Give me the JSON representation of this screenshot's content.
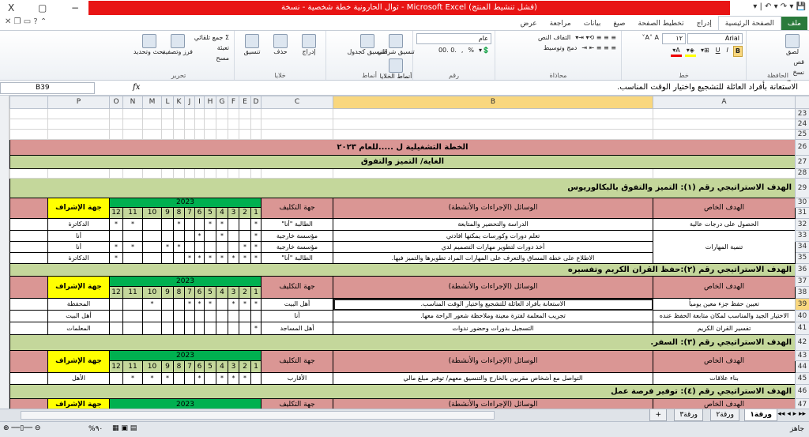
{
  "window": {
    "title": "ثوال الحارونية خطة شخصية - نسخة - Microsoft Excel (فشل تنشيط المنتج)",
    "close": "X",
    "restore": "▢",
    "minimize": "−"
  },
  "qat": "▾ | ↶ ▾ ↷ ▾ 💾",
  "ribbon_tabs": [
    "ملف",
    "الصفحة الرئيسية",
    "إدراج",
    "تخطيط الصفحة",
    "صيغ",
    "بيانات",
    "مراجعة",
    "عرض"
  ],
  "ribbon": {
    "clipboard": {
      "label": "الحافظة",
      "paste": "لصق",
      "cut": "قص",
      "copy": "نسخ",
      "format_painter": "نسخ التنسيق"
    },
    "font": {
      "label": "خط",
      "name": "Arial",
      "size": "١٢",
      "bold": "B",
      "italic": "I",
      "underline": "U"
    },
    "alignment": {
      "label": "محاذاة",
      "wrap": "التفاف النص",
      "merge": "دمج وتوسيط"
    },
    "number": {
      "label": "رقم",
      "format": "عام",
      "percent": "%",
      "comma": ","
    },
    "styles": {
      "label": "أنماط",
      "conditional": "تنسيق شرطي",
      "as_table": "التنسيق كجدول",
      "cell_styles": "أنماط الخلايا"
    },
    "cells": {
      "label": "خلايا",
      "insert": "إدراج",
      "delete": "حذف",
      "format": "تنسيق"
    },
    "editing": {
      "label": "تحرير",
      "autosum": "جمع تلقائي",
      "fill": "تعبئة",
      "clear": "مسح",
      "sort": "فرز وتصفية",
      "find": "بحث وتحديد"
    }
  },
  "formula_bar": {
    "name_box": "B39",
    "fx": "fx",
    "value": "الاستعانة بأفراد العائلة للتشجيع واختيار الوقت المناسب."
  },
  "columns": [
    "A",
    "B",
    "C",
    "D",
    "E",
    "F",
    "G",
    "H",
    "I",
    "J",
    "K",
    "L",
    "M",
    "N",
    "O",
    "P"
  ],
  "selected_cell": {
    "col": "B",
    "row": 39
  },
  "headers": {
    "goal": "الهدف الخاص",
    "means": "الوسائل (الإجراءات والأنشطة)",
    "assigned": "جهة التكليف",
    "year": "2023",
    "supervisor": "جهة الإشراف",
    "months": [
      "1",
      "2",
      "3",
      "4",
      "5",
      "6",
      "7",
      "8",
      "9",
      "10",
      "11",
      "12"
    ]
  },
  "sheet": {
    "title": "الخطة التشغيلية ل .....للعام ٢٠٢٣",
    "vision": "الغاية/ التميز والتفوق",
    "sections": [
      {
        "goal_row": 29,
        "goal": "الهدف الاستراتيجي رقم (١): التميز والتفوق بالبكالوريوس",
        "header_rows": [
          30,
          31
        ],
        "rows": [
          {
            "row": 32,
            "goal": "الحصول على درجات عالية",
            "means": "الدراسة والتحضير والمتابعة",
            "assigned": "الطالبة \"أنا\"",
            "months": [
              1,
              4,
              5,
              8,
              11,
              12
            ],
            "supervisor": "الدكاترة"
          },
          {
            "row": 33,
            "goal": "تنمية المهارات",
            "goal_span": 3,
            "means": "تعلم دورات وكورسات يمكنها افادتي",
            "assigned": "مؤسسة خارجية",
            "months": [
              1,
              4,
              6
            ],
            "supervisor": "أنا"
          },
          {
            "row": 34,
            "means": "أخذ دورات لتطوير مهارات التصميم لدي",
            "assigned": "مؤسسة خارجية",
            "months": [
              1,
              2,
              8,
              9,
              11,
              12
            ],
            "supervisor": "أنا"
          },
          {
            "row": 35,
            "means": "الاطلاع على خطة المساق والتعرف على المهارات المراد تطويرها والتميز فيها.",
            "assigned": "الطالبة \"أنا\"",
            "months": [
              1,
              2,
              3,
              4,
              5,
              6,
              7,
              12
            ],
            "supervisor": "الدكاترة"
          }
        ]
      },
      {
        "goal_row": 36,
        "goal": "الهدف الاستراتيجي رقم (٢):حفظ القران الكريم وتفسيره",
        "header_rows": [
          37,
          38
        ],
        "rows": [
          {
            "row": 39,
            "goal": "تعيين حفظ جزء معين يومياً",
            "means": "الاستعانة بأفراد العائلة للتشجيع واختيار الوقت المناسب.",
            "assigned": "أهل البيت",
            "months": [
              1,
              2,
              3,
              5,
              6,
              7,
              10
            ],
            "supervisor": "المحفظة"
          },
          {
            "row": 40,
            "goal": "الاختيار الجيد والمناسب لمكان متابعة الحفظ عنده",
            "means": "تجريب المعلمة لفترة معينة وملاحظة شعور الراحة معها.",
            "assigned": "أنا",
            "months": [],
            "supervisor": "أهل البيت"
          },
          {
            "row": 41,
            "goal": "تفسير القران الكريم",
            "means": "التسجيل بدورات وحضور ندوات",
            "assigned": "أهل المساجد",
            "months": [
              1
            ],
            "supervisor": "المعلمات"
          }
        ]
      },
      {
        "goal_row": 42,
        "goal": "الهدف الاستراتيجي رقم (٣): السفر.",
        "header_rows": [
          43,
          44
        ],
        "rows": [
          {
            "row": 45,
            "goal": "بناء علاقات",
            "means": "التواصل مع أشخاص مقربين بالخارج والتنسيق معهم/ توفير مبلغ مالي",
            "assigned": "الأقارب",
            "months": [
              2,
              3,
              4,
              6,
              9,
              10,
              11
            ],
            "supervisor": "الأهل"
          }
        ]
      },
      {
        "goal_row": 46,
        "goal": "الهدف الاستراتيجي رقم (٤): توفير فرصة عمل",
        "header_rows": [
          47
        ],
        "rows": []
      }
    ],
    "mark": "*"
  },
  "sheet_tabs": [
    "ورقة١",
    "ورقة٢",
    "ورقة٣"
  ],
  "status": {
    "ready": "جاهز",
    "zoom": "%٩٠"
  },
  "colors": {
    "pink": "#da9694",
    "green": "#c4d79b",
    "month_green": "#00b050",
    "yellow": "#ffff00",
    "title_red": "#e81414"
  }
}
